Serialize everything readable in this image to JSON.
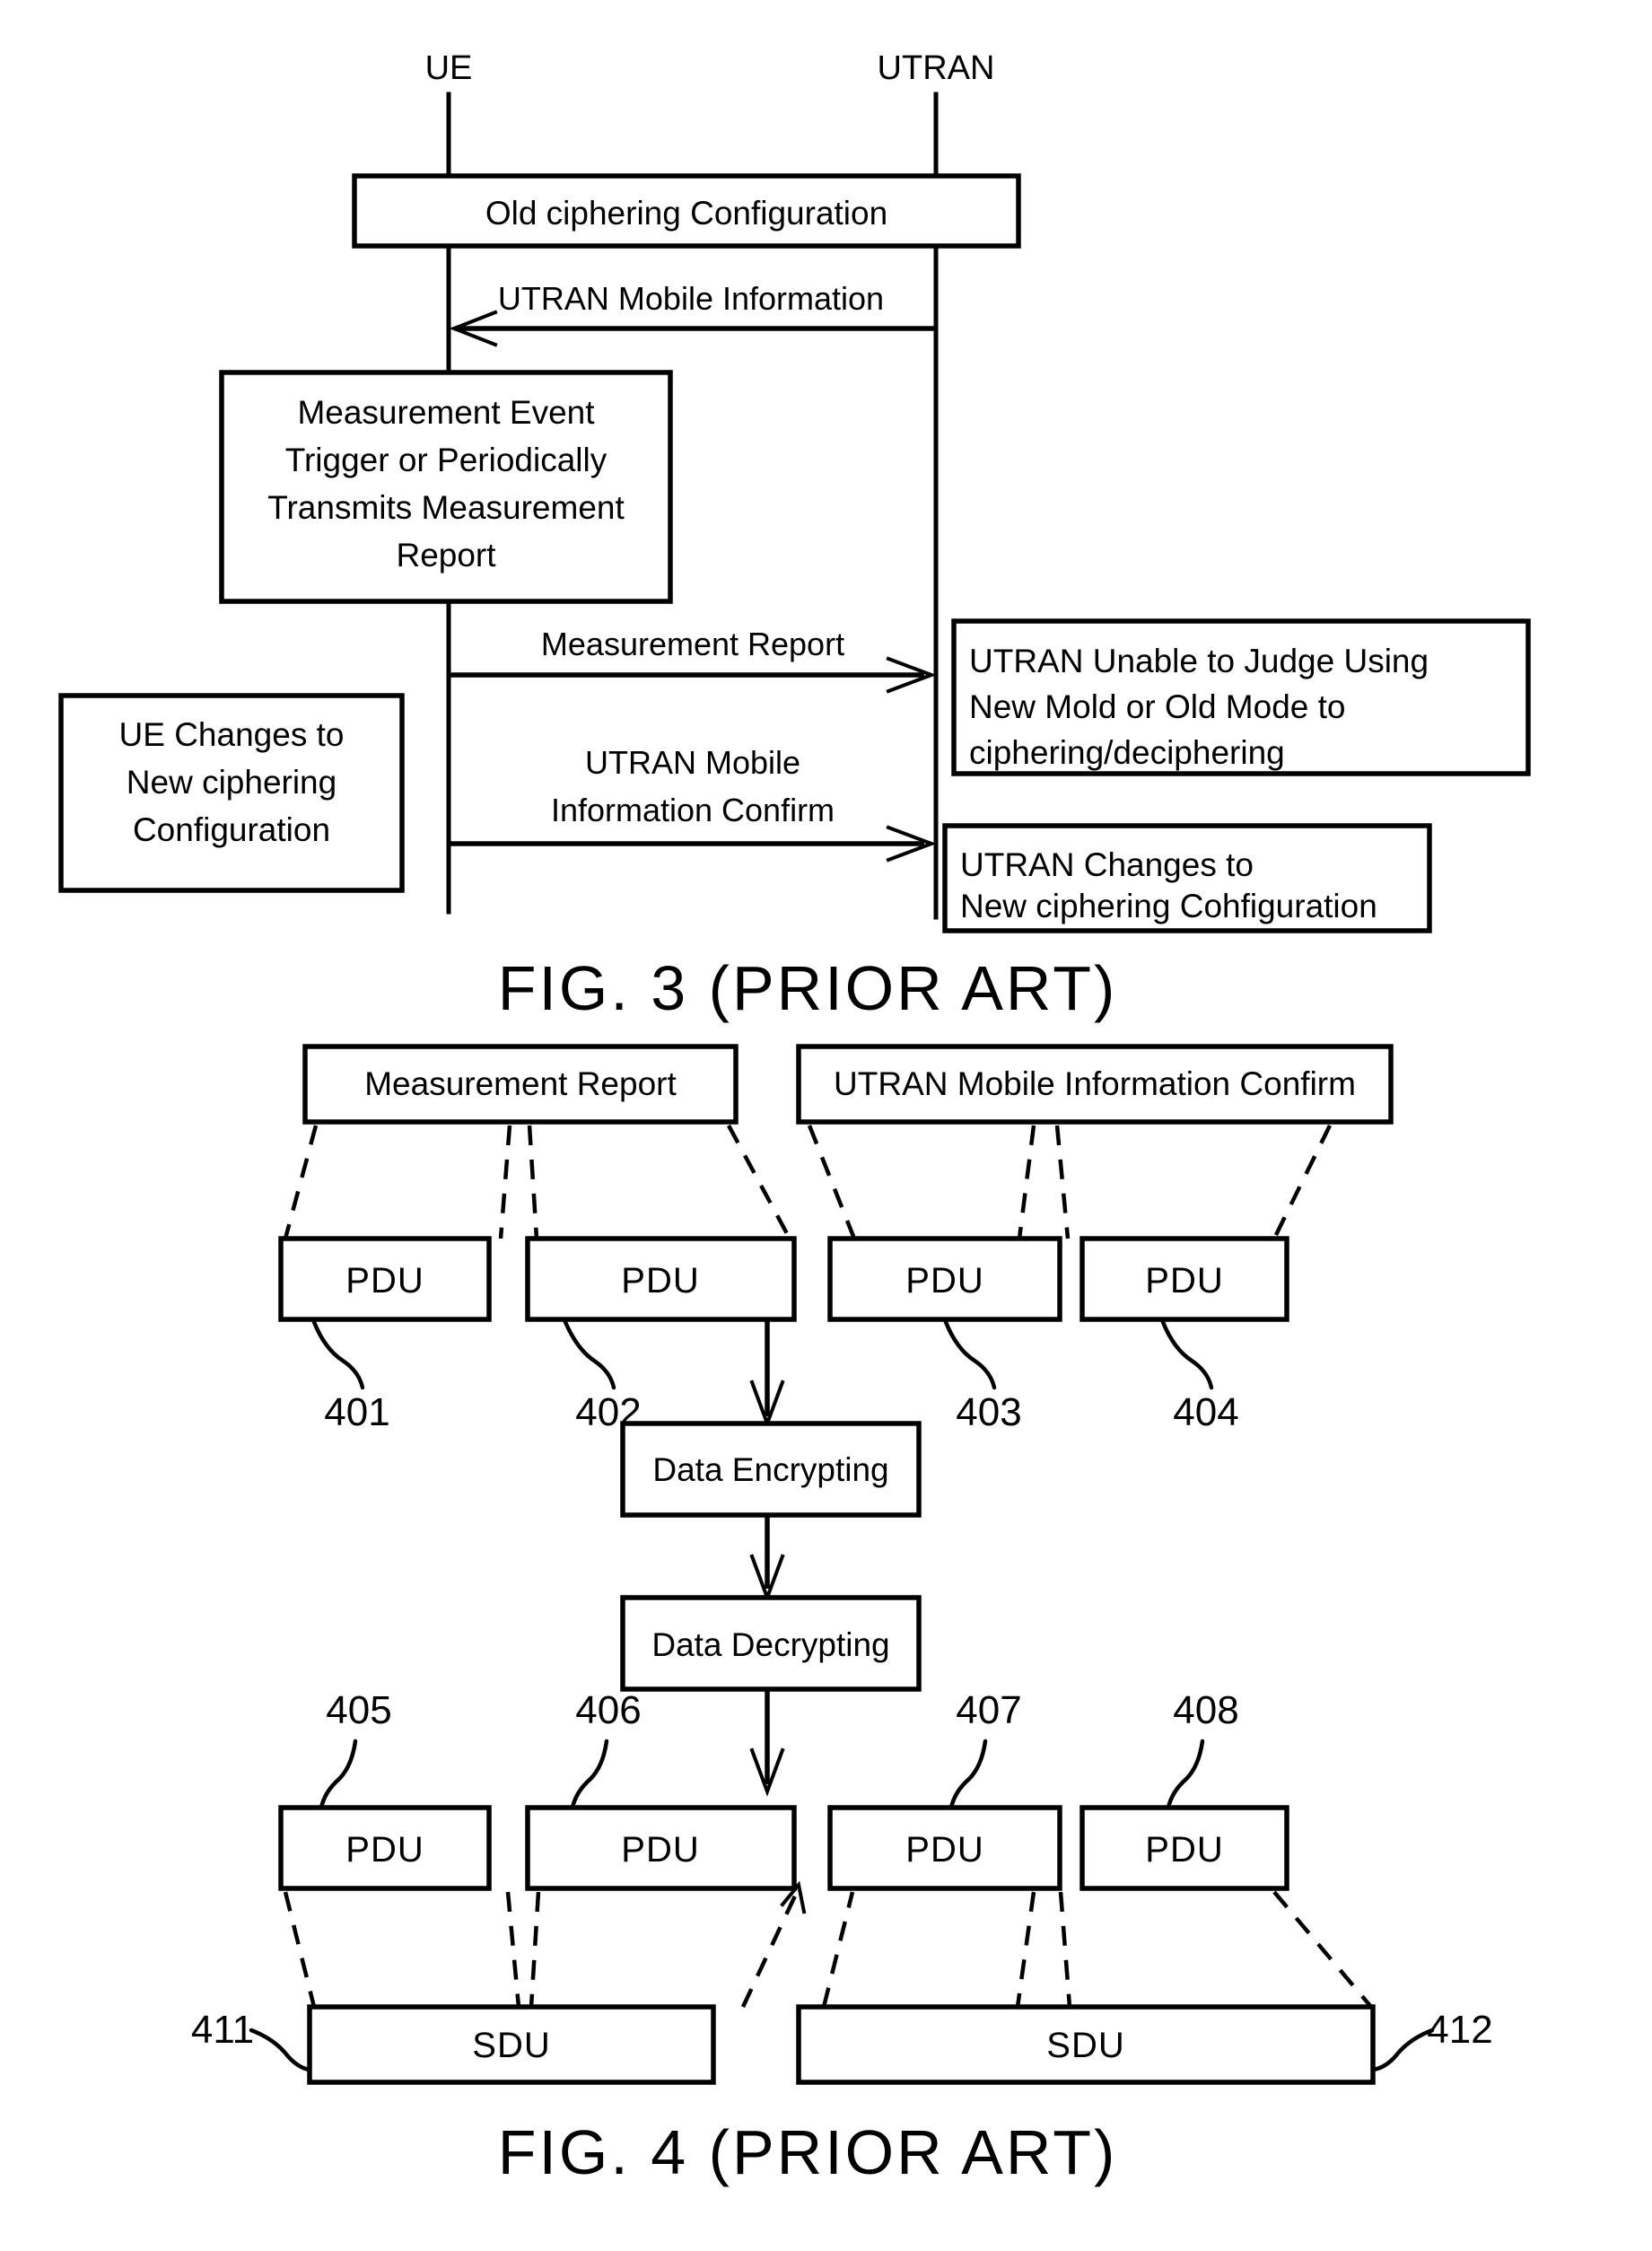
{
  "document": {
    "type": "patent-drawing-sheet",
    "figures": [
      {
        "id": "fig3",
        "caption": "FIG. 3 (PRIOR ART)",
        "kind": "sequence-diagram",
        "lifelines": [
          {
            "id": "ue",
            "label": "UE"
          },
          {
            "id": "utran",
            "label": "UTRAN"
          }
        ],
        "boxes": [
          {
            "id": "old-config",
            "lines": [
              "Old ciphering Configuration"
            ]
          },
          {
            "id": "measurement-event",
            "lines": [
              "Measurement Event",
              "Trigger or Periodically",
              "Transmits Measurement",
              "Report"
            ]
          },
          {
            "id": "ue-changes",
            "lines": [
              "UE Changes to",
              "New ciphering",
              "Configuration"
            ]
          },
          {
            "id": "utran-unable",
            "lines": [
              "UTRAN Unable to Judge Using",
              "New Mold or Old Mode to",
              "ciphering/deciphering"
            ]
          },
          {
            "id": "utran-changes",
            "lines": [
              "UTRAN Changes to",
              "New ciphering Cohfiguration"
            ]
          }
        ],
        "messages": [
          {
            "id": "msg-utran-mobile-info",
            "label": "UTRAN Mobile Information",
            "direction": "utran-to-ue"
          },
          {
            "id": "msg-measurement-report",
            "label": "Measurement Report",
            "direction": "ue-to-utran"
          },
          {
            "id": "msg-utran-mobile-info-confirm",
            "lines": [
              "UTRAN Mobile",
              "Information Confirm"
            ],
            "direction": "ue-to-utran"
          }
        ]
      },
      {
        "id": "fig4",
        "caption": "FIG. 4 (PRIOR ART)",
        "kind": "block-diagram",
        "message_boxes": [
          {
            "id": "mb-measurement-report",
            "label": "Measurement Report"
          },
          {
            "id": "mb-utran-confirm",
            "label": "UTRAN Mobile Information Confirm"
          }
        ],
        "pdu_top": [
          {
            "id": "pdu-401",
            "label": "PDU",
            "ref": "401"
          },
          {
            "id": "pdu-402",
            "label": "PDU",
            "ref": "402"
          },
          {
            "id": "pdu-403",
            "label": "PDU",
            "ref": "403"
          },
          {
            "id": "pdu-404",
            "label": "PDU",
            "ref": "404"
          }
        ],
        "process_boxes": [
          {
            "id": "data-encrypting",
            "label": "Data Encrypting"
          },
          {
            "id": "data-decrypting",
            "label": "Data Decrypting"
          }
        ],
        "pdu_bottom": [
          {
            "id": "pdu-405",
            "label": "PDU",
            "ref": "405"
          },
          {
            "id": "pdu-406",
            "label": "PDU",
            "ref": "406"
          },
          {
            "id": "pdu-407",
            "label": "PDU",
            "ref": "407"
          },
          {
            "id": "pdu-408",
            "label": "PDU",
            "ref": "408"
          }
        ],
        "sdu_boxes": [
          {
            "id": "sdu-411",
            "label": "SDU",
            "ref": "411"
          },
          {
            "id": "sdu-412",
            "label": "SDU",
            "ref": "412"
          }
        ]
      }
    ]
  },
  "colors": {
    "ink": "#000000",
    "paper": "#ffffff"
  }
}
